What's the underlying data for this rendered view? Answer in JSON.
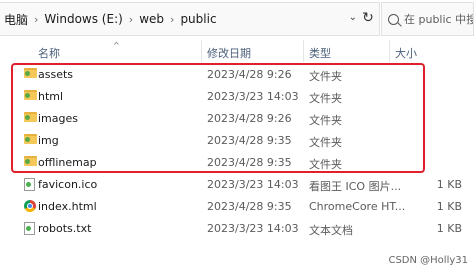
{
  "address_bar": {
    "crumbs": [
      "电脑",
      "Windows (E:)",
      "web",
      "public"
    ],
    "separator": "›",
    "dropdown_glyph": "⌄",
    "refresh_glyph": "↻"
  },
  "search": {
    "placeholder": "在 public 中搜索"
  },
  "columns": {
    "name": "名称",
    "date": "修改日期",
    "type": "类型",
    "size": "大小"
  },
  "files": [
    {
      "icon": "folder-icon",
      "name": "assets",
      "date": "2023/4/28 9:26",
      "type": "文件夹",
      "size": ""
    },
    {
      "icon": "folder-icon",
      "name": "html",
      "date": "2023/3/23 14:03",
      "type": "文件夹",
      "size": ""
    },
    {
      "icon": "folder-icon",
      "name": "images",
      "date": "2023/4/28 9:26",
      "type": "文件夹",
      "size": ""
    },
    {
      "icon": "folder-icon",
      "name": "img",
      "date": "2023/4/28 9:35",
      "type": "文件夹",
      "size": ""
    },
    {
      "icon": "folder-icon",
      "name": "offlinemap",
      "date": "2023/4/28 9:35",
      "type": "文件夹",
      "size": ""
    },
    {
      "icon": "ico-file-icon",
      "name": "favicon.ico",
      "date": "2023/3/23 14:03",
      "type": "看图王 ICO 图片...",
      "size": "1 KB"
    },
    {
      "icon": "chrome-html-icon",
      "name": "index.html",
      "date": "2023/4/28 9:35",
      "type": "ChromeCore HT...",
      "size": "1 KB"
    },
    {
      "icon": "text-file-icon",
      "name": "robots.txt",
      "date": "2023/3/23 14:03",
      "type": "文本文档",
      "size": "1 KB"
    }
  ],
  "watermark": "CSDN @Holly31",
  "colors": {
    "highlight": "#e0202a",
    "folder": "#f5c85a",
    "header_text": "#4c607a"
  }
}
